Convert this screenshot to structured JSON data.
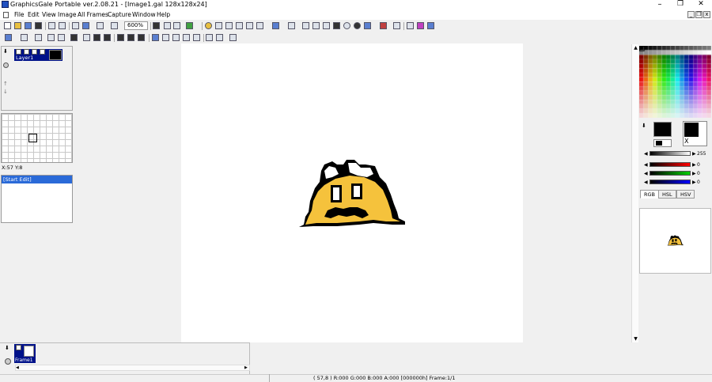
{
  "window": {
    "title": "GraphicsGale Portable ver.2.08.21 - [Image1.gal 128x128x24]",
    "minimize": "–",
    "restore": "❐",
    "close": "✕"
  },
  "menu": {
    "items": [
      "File",
      "Edit",
      "View",
      "Image",
      "All Frames",
      "Capture",
      "Window",
      "Help"
    ]
  },
  "mdi": {
    "minimize": "_",
    "restore": "❐",
    "close": "x"
  },
  "toolbar": {
    "zoom": "600%"
  },
  "layers": {
    "items": [
      {
        "label": "Layer1"
      }
    ]
  },
  "navigator": {
    "coordinates": "X:57 Y:8"
  },
  "history": {
    "items": [
      "[Start Edit]"
    ]
  },
  "color": {
    "primary": "#000000",
    "transparent_label": "X",
    "sliders": [
      {
        "name": "value",
        "value": "255",
        "gradient": "linear-gradient(90deg,#000,#fff)"
      },
      {
        "name": "red",
        "value": "0",
        "gradient": "linear-gradient(90deg,#000,#f00)"
      },
      {
        "name": "green",
        "value": "0",
        "gradient": "linear-gradient(90deg,#000,#0c0)"
      },
      {
        "name": "blue",
        "value": "0",
        "gradient": "linear-gradient(90deg,#000,#00f)"
      }
    ],
    "tabs": [
      "RGB",
      "HSL",
      "HSV"
    ],
    "active_tab": "RGB"
  },
  "frames": {
    "items": [
      {
        "label": "Frame1"
      }
    ]
  },
  "status": {
    "text": "( 57,8 ) R:000 G:000 B:000 A:000  [000000h]  Frame:1/1"
  },
  "sprite": {
    "fill": "#f5c23c",
    "outline": "#000000",
    "eye_white": "#ffffff"
  }
}
